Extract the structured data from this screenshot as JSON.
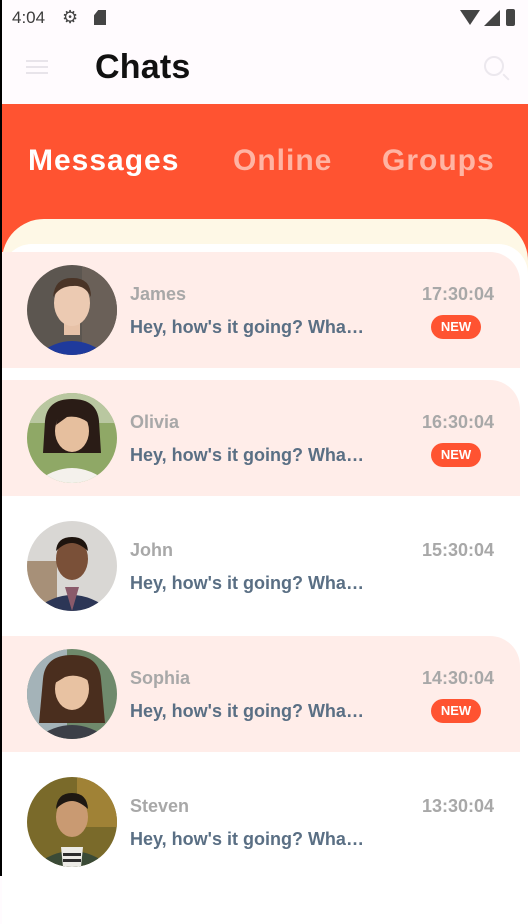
{
  "status_bar": {
    "time": "4:04",
    "icons": [
      "gear-icon",
      "sd-card-icon",
      "wifi-icon",
      "signal-icon",
      "battery-icon"
    ]
  },
  "app_bar": {
    "title": "Chats",
    "menu_icon": "menu-icon",
    "search_icon": "search-icon"
  },
  "tabs": [
    {
      "label": "Messages",
      "active": true
    },
    {
      "label": "Online",
      "active": false
    },
    {
      "label": "Groups",
      "active": false
    }
  ],
  "colors": {
    "accent": "#ff5331",
    "unread_background": "#ffede9",
    "panel_background": "#fef8e6",
    "name_text": "#a8a8a8",
    "preview_text": "#5a6f84"
  },
  "chats": [
    {
      "name": "James",
      "preview": "Hey, how's it going? What did you do today?",
      "time": "17:30:04",
      "badge": "NEW",
      "unread": true
    },
    {
      "name": "Olivia",
      "preview": "Hey, how's it going? What did you do today?",
      "time": "16:30:04",
      "badge": "NEW",
      "unread": true
    },
    {
      "name": "John",
      "preview": "Hey, how's it going? What did you do today?",
      "time": "15:30:04",
      "badge": "",
      "unread": false
    },
    {
      "name": "Sophia",
      "preview": "Hey, how's it going? What did you do today?",
      "time": "14:30:04",
      "badge": "NEW",
      "unread": true
    },
    {
      "name": "Steven",
      "preview": "Hey, how's it going? What did you do today?",
      "time": "13:30:04",
      "badge": "",
      "unread": false
    }
  ]
}
